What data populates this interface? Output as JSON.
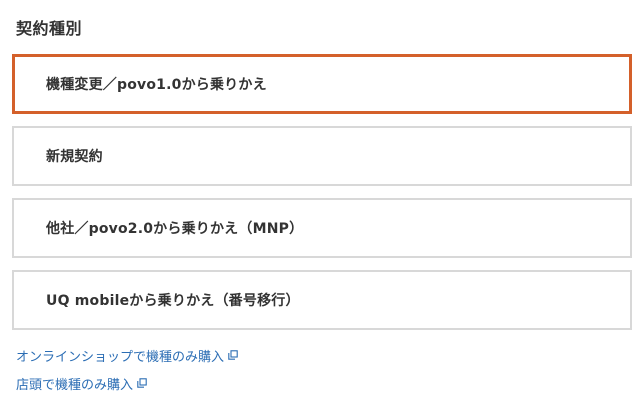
{
  "section": {
    "title": "契約種別"
  },
  "options": [
    {
      "label": "機種変更／povo1.0から乗りかえ",
      "selected": true
    },
    {
      "label": "新規契約",
      "selected": false
    },
    {
      "label": "他社／povo2.0から乗りかえ（MNP）",
      "selected": false
    },
    {
      "label": "UQ mobileから乗りかえ（番号移行）",
      "selected": false
    }
  ],
  "links": [
    {
      "label": "オンラインショップで機種のみ購入",
      "icon": "external-link-icon"
    },
    {
      "label": "店頭で機種のみ購入",
      "icon": "external-link-icon"
    }
  ],
  "colors": {
    "selected_border": "#d4602a",
    "default_border": "#d8d8d8",
    "link": "#2b6db4",
    "text": "#333333"
  }
}
